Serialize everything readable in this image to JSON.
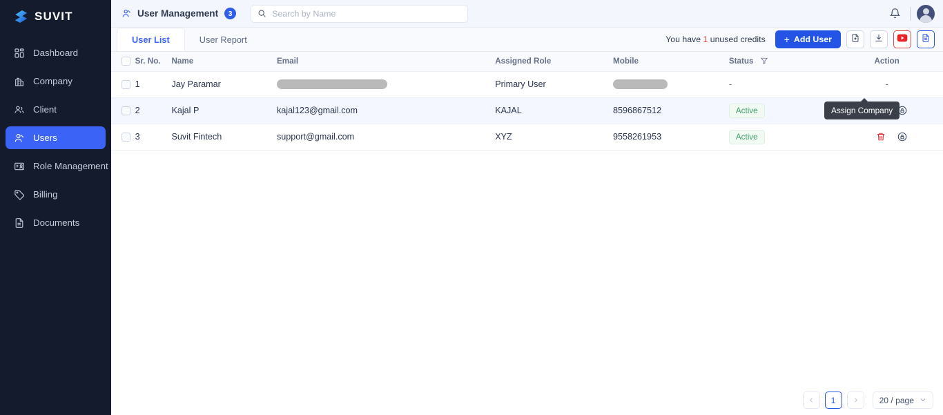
{
  "brand": {
    "name": "SUVIT",
    "logo_icon": "suvit-logo-icon"
  },
  "sidebar": {
    "items": [
      {
        "label": "Dashboard",
        "icon": "grid-icon",
        "active": false
      },
      {
        "label": "Company",
        "icon": "building-icon",
        "active": false
      },
      {
        "label": "Client",
        "icon": "group-icon",
        "active": false
      },
      {
        "label": "Users",
        "icon": "user-plus-icon",
        "active": true
      },
      {
        "label": "Role Management",
        "icon": "id-card-icon",
        "active": false
      },
      {
        "label": "Billing",
        "icon": "tag-icon",
        "active": false
      },
      {
        "label": "Documents",
        "icon": "document-icon",
        "active": false
      }
    ]
  },
  "topbar": {
    "title": "User Management",
    "title_icon": "users-icon",
    "count_badge": "3",
    "search": {
      "value": "",
      "placeholder": "Search by Name",
      "icon": "search-icon"
    },
    "bell_icon": "bell-icon",
    "avatar_icon": "user-avatar"
  },
  "tabs": [
    {
      "label": "User List",
      "active": true
    },
    {
      "label": "User Report",
      "active": false
    }
  ],
  "toolbar": {
    "credits_prefix": "You have",
    "credits_count": "1",
    "credits_suffix": "unused credits",
    "add_user_label": "Add User",
    "add_user_plus": "+",
    "buttons": [
      {
        "name": "upload-file-button",
        "icon": "file-upload-icon",
        "style": "default"
      },
      {
        "name": "download-button",
        "icon": "download-icon",
        "style": "default"
      },
      {
        "name": "youtube-help-button",
        "icon": "youtube-icon",
        "style": "red"
      },
      {
        "name": "report-doc-button",
        "icon": "file-text-icon",
        "style": "blue"
      }
    ]
  },
  "table": {
    "columns": [
      {
        "key": "checkbox",
        "label": ""
      },
      {
        "key": "sr",
        "label": "Sr. No."
      },
      {
        "key": "name",
        "label": "Name"
      },
      {
        "key": "email",
        "label": "Email"
      },
      {
        "key": "role",
        "label": "Assigned Role"
      },
      {
        "key": "mobile",
        "label": "Mobile"
      },
      {
        "key": "status",
        "label": "Status"
      },
      {
        "key": "action",
        "label": "Action"
      }
    ],
    "status_filter_icon": "filter-icon",
    "rows": [
      {
        "sr": "1",
        "name": "Jay Paramar",
        "email": "",
        "email_redacted": true,
        "role": "Primary User",
        "mobile": "",
        "mobile_redacted": true,
        "status": "-",
        "status_badge": false,
        "action": "-",
        "has_actions": false,
        "hovered": false
      },
      {
        "sr": "2",
        "name": "Kajal P",
        "email": "kajal123@gmail.com",
        "email_redacted": false,
        "role": "KAJAL",
        "mobile": "8596867512",
        "mobile_redacted": false,
        "status": "Active",
        "status_badge": true,
        "action": "",
        "has_actions": true,
        "hovered": true
      },
      {
        "sr": "3",
        "name": "Suvit Fintech",
        "email": "support@gmail.com",
        "email_redacted": false,
        "role": "XYZ",
        "mobile": "9558261953",
        "mobile_redacted": false,
        "status": "Active",
        "status_badge": true,
        "action": "",
        "has_actions": true,
        "hovered": false
      }
    ],
    "row_actions": [
      {
        "name": "view-button",
        "icon": "eye-icon"
      },
      {
        "name": "edit-button",
        "icon": "pencil-icon"
      },
      {
        "name": "delete-button",
        "icon": "trash-icon"
      },
      {
        "name": "assign-company-button",
        "icon": "lock-refresh-icon"
      }
    ]
  },
  "tooltip": {
    "text": "Assign Company"
  },
  "pagination": {
    "prev_icon": "chevron-left-icon",
    "next_icon": "chevron-right-icon",
    "current_page": "1",
    "per_page_label": "20 / page",
    "per_page_icon": "chevron-down-icon"
  },
  "colors": {
    "accent": "#2354e6",
    "sidebar_bg": "#141b2d",
    "sidebar_active": "#3b64f6",
    "status_active": "#3f9d6a",
    "credits_number": "#e0453a",
    "danger": "#e5484d"
  }
}
